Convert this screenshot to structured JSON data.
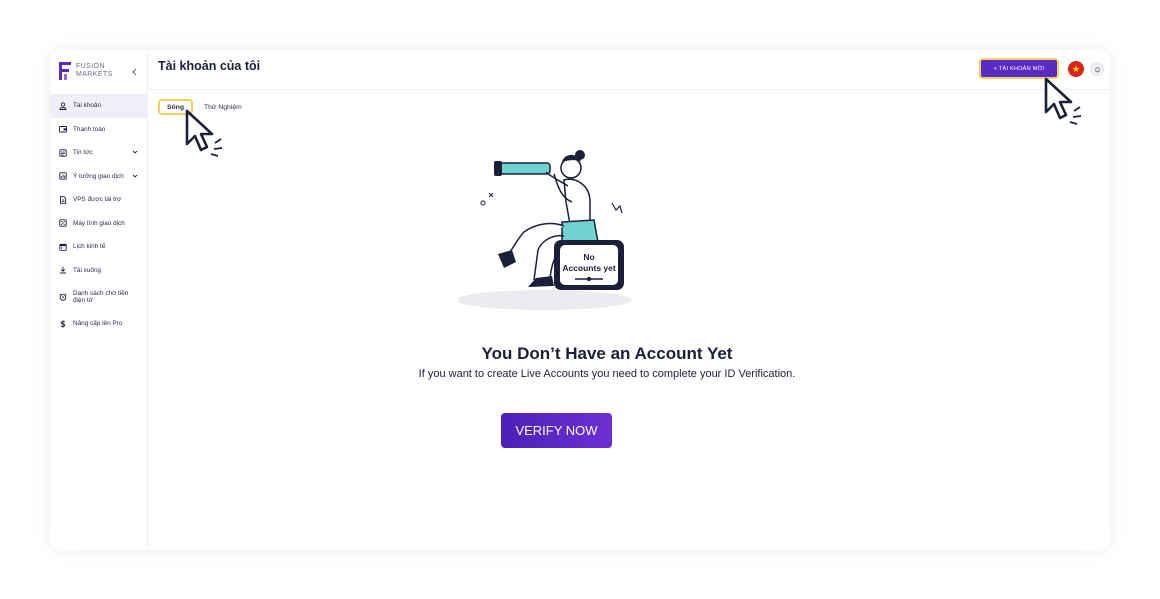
{
  "brand": {
    "line1": "FUSION",
    "line2": "MARKETS",
    "accent": "#5a2bc2"
  },
  "sidebar": {
    "collapse_icon": "chevron-left-icon",
    "items": [
      {
        "label": "Tài khoản",
        "icon": "user-icon",
        "active": true
      },
      {
        "label": "Thanh toán",
        "icon": "wallet-icon"
      },
      {
        "label": "Tin tức",
        "icon": "news-icon",
        "has_chevron": true
      },
      {
        "label": "Ý tưởng giao dịch",
        "icon": "chart-icon",
        "has_chevron": true
      },
      {
        "label": "VPS được tài trợ",
        "icon": "document-icon"
      },
      {
        "label": "Máy tính giao dịch",
        "icon": "calculator-icon"
      },
      {
        "label": "Lịch kinh tế",
        "icon": "calendar-icon"
      },
      {
        "label": "Tải xuống",
        "icon": "download-icon"
      },
      {
        "label": "Danh sách chờ tiền điện tử",
        "icon": "alarm-icon"
      },
      {
        "label": "Nâng cấp lên Pro",
        "icon": "dollar-icon"
      }
    ]
  },
  "header": {
    "title": "Tài khoản của tôi",
    "new_account_label": "+ TÀI KHOẢN MỚI",
    "language_icon": "vietnam-flag-icon",
    "bell_icon": "bell-icon"
  },
  "tabs": [
    {
      "label": "Sống",
      "active": true
    },
    {
      "label": "Thử Nghiệm",
      "active": false
    }
  ],
  "empty_state": {
    "sign_line1": "No",
    "sign_line2": "Accounts yet",
    "heading": "You Don’t Have an Account Yet",
    "subtext": "If you want to create Live Accounts you need to complete your ID Verification.",
    "cta_label": "VERIFY NOW"
  },
  "colors": {
    "primary": "#5a2bc2",
    "highlight": "#f4cf5e",
    "teal": "#6fd3cf",
    "navy": "#1c1f3a"
  }
}
